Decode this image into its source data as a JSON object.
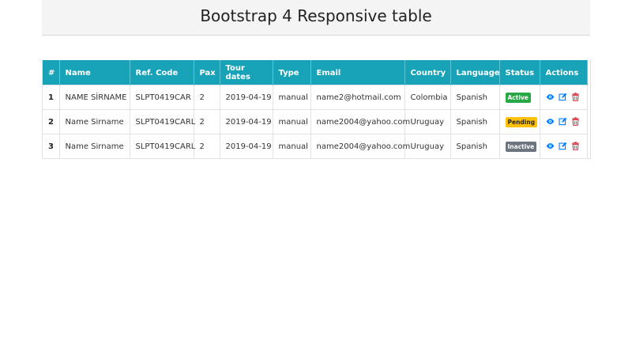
{
  "page": {
    "title": "Bootstrap 4 Responsive table"
  },
  "table": {
    "headers": [
      "#",
      "Name",
      "Ref. Code",
      "Pax",
      "Tour dates",
      "Type",
      "Email",
      "Country",
      "Language",
      "Status",
      "Actions"
    ],
    "rows": [
      {
        "num": "1",
        "name": "NAME SİRNAME",
        "ref": "SLPT0419CAR",
        "pax": "2",
        "date": "2019-04-19",
        "type": "manual",
        "email": "name2@hotmail.com",
        "country": "Colombia",
        "language": "Spanish",
        "status": "Active"
      },
      {
        "num": "2",
        "name": "Name Sirname",
        "ref": "SLPT0419CARL",
        "pax": "2",
        "date": "2019-04-19",
        "type": "manual",
        "email": "name2004@yahoo.com",
        "country": "Uruguay",
        "language": "Spanish",
        "status": "Pending"
      },
      {
        "num": "3",
        "name": "Name Sirname",
        "ref": "SLPT0419CARL",
        "pax": "2",
        "date": "2019-04-19",
        "type": "manual",
        "email": "name2004@yahoo.com",
        "country": "Uruguay",
        "language": "Spanish",
        "status": "Inactive"
      }
    ],
    "actions": [
      "eye-icon",
      "edit-icon",
      "trash-icon"
    ]
  },
  "colors": {
    "header": "#17a2b8",
    "active": "#28a745",
    "pending": "#ffc107",
    "inactive": "#6c757d",
    "view": "#007bff",
    "delete": "#dc3545"
  }
}
